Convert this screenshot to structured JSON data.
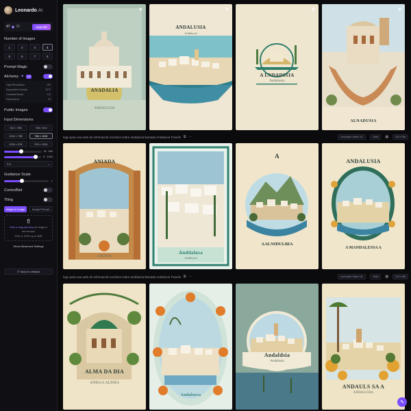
{
  "app": {
    "name": "Leonardo",
    "name_suffix": ".Ai"
  },
  "tokens": {
    "count": "47",
    "secondary": "30",
    "upgrade_label": "Upgrade"
  },
  "sidebar": {
    "num_images_label": "Number of Images",
    "num_options": [
      "1",
      "2",
      "3",
      "4",
      "5",
      "6",
      "7",
      "8"
    ],
    "prompt_magic_label": "Prompt Magic",
    "alchemy_label": "Alchemy",
    "alchemy_badge": "V2",
    "alchemy_settings": [
      {
        "name": "High Resolution",
        "value": "ON"
      },
      {
        "name": "Expanded Domain",
        "value": "OFF"
      },
      {
        "name": "Contrast Boost",
        "value": "0.5"
      },
      {
        "name": "Resonance",
        "value": "15"
      }
    ],
    "public_images_label": "Public Images",
    "input_dimensions_label": "Input Dimensions",
    "dimensions": [
      "512 × 768",
      "768 × 512",
      "1024 × 768",
      "768 × 1024",
      "1024 × 576",
      "576 × 1024"
    ],
    "width_label": "W",
    "width_value": "640",
    "height_label": "H",
    "height_value": "1024",
    "width_level": 0.45,
    "height_level": 0.85,
    "ratio_value": "2:3",
    "guidance_label": "Guidance Scale",
    "guidance_value": "7",
    "guidance_level": 0.4,
    "controlnet_label": "ControlNet",
    "tiling_label": "Tiling",
    "tabs": [
      "Image to Image",
      "Image Prompt"
    ],
    "upload_text_1": "Click or drag and drop",
    "upload_text_2": "an image to",
    "upload_text_3": "use as input",
    "upload_text_4": "PNG or JPEG up to 5MB",
    "advanced_label": "Show Advanced Settings",
    "back_label": "Back to defaults"
  },
  "prompt_bar": {
    "text": "logo para una web de información turística sobre andalucía llamada Andalucía Travels",
    "model_chip": "Leonardo Vision XL",
    "view_chip": "Vivid",
    "size_chip": "512×768"
  },
  "posters": {
    "r1c1": {
      "title": "ANADALIA",
      "sub": "ANDALUCIA"
    },
    "r1c2": {
      "title": "ANDALUSIA",
      "sub": "Andalucia"
    },
    "r1c3": {
      "title": "A LNDADSSIA",
      "sub": "Andalussia"
    },
    "r1c4": {
      "title": "ALNADUSIA",
      "sub": ""
    },
    "r2c1": {
      "title": "ANIADA",
      "sub": "LIBADA"
    },
    "r2c2": {
      "title": "Anddalusa",
      "sub": "Andalusia"
    },
    "r2c3": {
      "title": "A",
      "sub": "AALNIDULBIA"
    },
    "r2c4": {
      "title": "ANDALUSIA",
      "sub": "A MANDALESSA A"
    },
    "r3c1": {
      "title": "ALMA DA DIA",
      "sub": "ANDAA ALSSIA"
    },
    "r3c2": {
      "title": "Andalusca",
      "sub": ""
    },
    "r3c3": {
      "title": "Andaldsia",
      "sub": "Andalusia"
    },
    "r3c4": {
      "title": "ANDAULS SA A",
      "sub": "ANDALUSIA"
    }
  },
  "colors": {
    "accent": "#7b4dff",
    "background": "#0b0b0e"
  }
}
